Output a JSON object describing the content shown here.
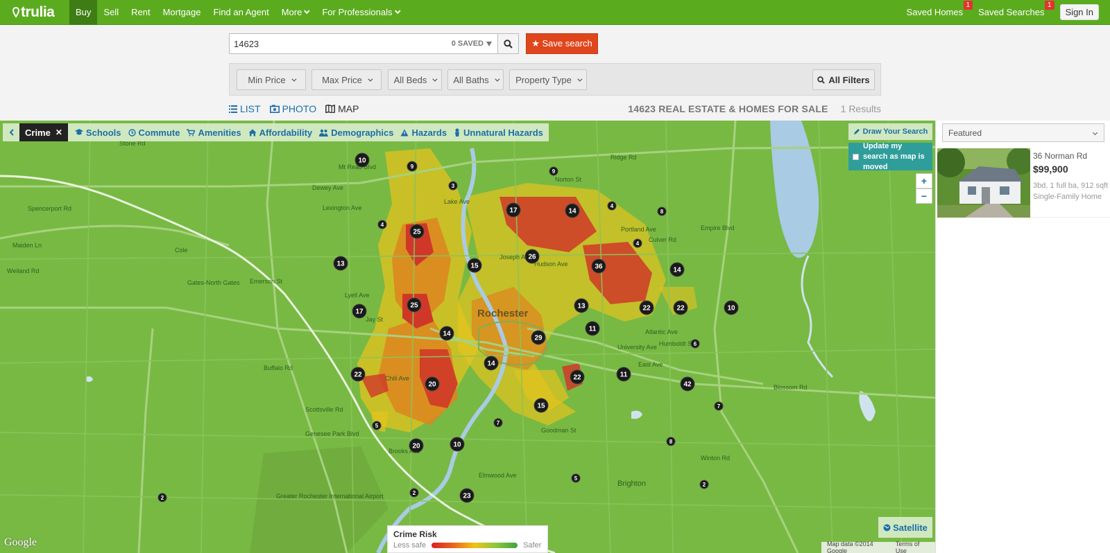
{
  "nav": {
    "logo": "trulia",
    "items": [
      {
        "label": "Buy",
        "active": true,
        "dropdown": false
      },
      {
        "label": "Sell",
        "active": false,
        "dropdown": false
      },
      {
        "label": "Rent",
        "active": false,
        "dropdown": false
      },
      {
        "label": "Mortgage",
        "active": false,
        "dropdown": false
      },
      {
        "label": "Find an Agent",
        "active": false,
        "dropdown": false
      },
      {
        "label": "More",
        "active": false,
        "dropdown": true
      },
      {
        "label": "For Professionals",
        "active": false,
        "dropdown": true
      }
    ],
    "saved_homes": "Saved Homes",
    "saved_homes_count": "1",
    "saved_searches": "Saved Searches",
    "saved_searches_count": "1",
    "sign_in": "Sign In"
  },
  "search": {
    "query": "14623",
    "saved_label": "0 SAVED",
    "save_button": "★ Save search"
  },
  "filters": {
    "min_price": "Min Price",
    "max_price": "Max Price",
    "beds": "All Beds",
    "baths": "All Baths",
    "property_type": "Property Type",
    "all_filters": "All Filters"
  },
  "view": {
    "list": "LIST",
    "photo": "PHOTO",
    "map": "MAP",
    "active": "map",
    "results_title": "14623 REAL ESTATE & HOMES FOR SALE",
    "results_count": "1 Results"
  },
  "map": {
    "layers": {
      "active": "Crime",
      "items": [
        "Schools",
        "Commute",
        "Amenities",
        "Affordability",
        "Demographics",
        "Hazards",
        "Unnatural Hazards"
      ]
    },
    "draw_search": "Draw Your Search",
    "update_search": "Update my search as map is moved",
    "zoom_in": "+",
    "zoom_out": "−",
    "legend": {
      "title": "Crime Risk",
      "low": "Less safe",
      "high": "Safer"
    },
    "satellite": "Satellite",
    "google": "Google",
    "map_data": "Map data ©2014 Google",
    "terms": "Terms of Use",
    "city_label": "Rochester",
    "places": [
      "Gates-North Gates",
      "Cole",
      "Brighton",
      "Greater Rochester International Airport"
    ],
    "roads": [
      "Ridge Rd",
      "Norton St",
      "Lexington Ave",
      "Lyell Ave",
      "Spencerport Rd",
      "Empire Blvd",
      "Atlantic Ave",
      "Buffalo Rd",
      "Brooks Ave",
      "University Ave",
      "East Ave",
      "Elmwood Ave",
      "Blossom Rd",
      "Humboldt St",
      "Emerson St",
      "Jay St",
      "Chili Ave",
      "Weiland Rd",
      "Stone Rd",
      "Maiden Ln",
      "Dewey Ave",
      "Culver Rd",
      "Portland Ave",
      "Joseph Ave",
      "Hudson Ave",
      "Goodman St",
      "Winton Rd",
      "Mt Read Blvd",
      "Lake Ave",
      "Scottsville Rd",
      "Genesee Park Blvd"
    ],
    "clusters": [
      "10",
      "9",
      "3",
      "9",
      "4",
      "25",
      "17",
      "14",
      "4",
      "8",
      "13",
      "15",
      "26",
      "36",
      "4",
      "14",
      "17",
      "25",
      "13",
      "22",
      "22",
      "10",
      "14",
      "29",
      "11",
      "22",
      "14",
      "20",
      "22",
      "15",
      "11",
      "42",
      "5",
      "6",
      "20",
      "10",
      "7",
      "7",
      "8",
      "2",
      "5",
      "2",
      "23",
      "2"
    ],
    "colors": {
      "map_base": "#78b944",
      "high_risk": "#d91f27",
      "mid_risk": "#f1c214",
      "cluster": "#1a1a1a",
      "nav": "#5bab1f",
      "accent": "#e0461c",
      "link": "#1c6ea8"
    }
  },
  "sort": {
    "selected": "Featured"
  },
  "listing": {
    "address": "36 Norman Rd",
    "price": "$99,900",
    "details": "3bd, 1 full ba, 912 sqft",
    "type": "Single-Family Home"
  }
}
